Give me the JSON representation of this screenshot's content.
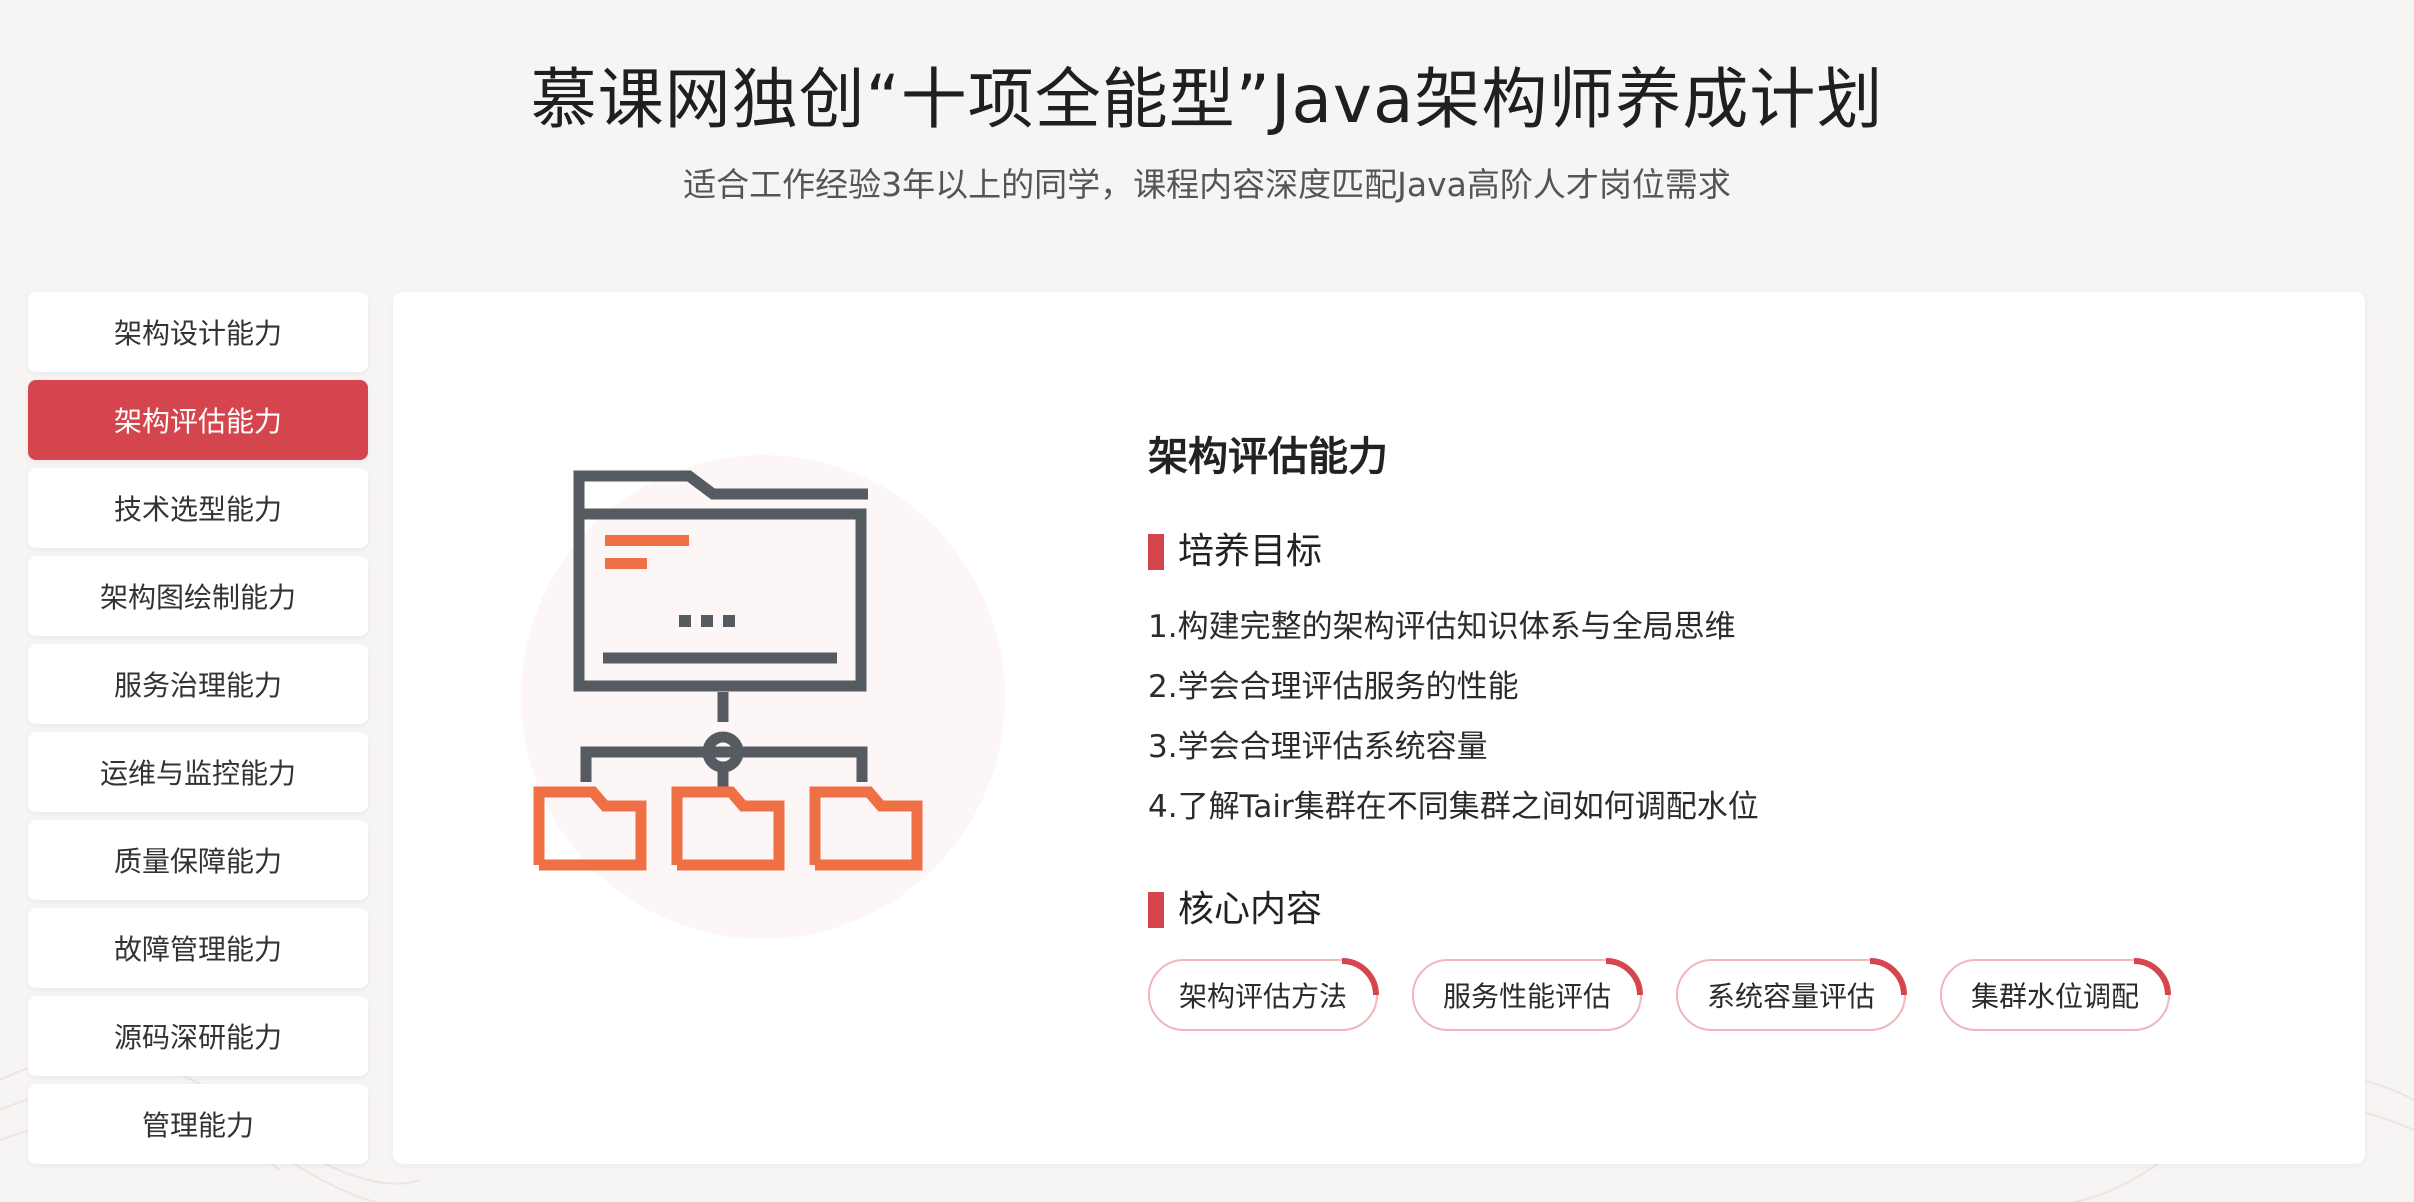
{
  "header": {
    "title": "慕课网独创“十项全能型”Java架构师养成计划",
    "subtitle": "适合工作经验3年以上的同学，课程内容深度匹配Java高阶人才岗位需求"
  },
  "sidebar": {
    "items": [
      {
        "label": "架构设计能力",
        "active": false
      },
      {
        "label": "架构评估能力",
        "active": true
      },
      {
        "label": "技术选型能力",
        "active": false
      },
      {
        "label": "架构图绘制能力",
        "active": false
      },
      {
        "label": "服务治理能力",
        "active": false
      },
      {
        "label": "运维与监控能力",
        "active": false
      },
      {
        "label": "质量保障能力",
        "active": false
      },
      {
        "label": "故障管理能力",
        "active": false
      },
      {
        "label": "源码深研能力",
        "active": false
      },
      {
        "label": "管理能力",
        "active": false
      }
    ]
  },
  "main": {
    "section_title": "架构评估能力",
    "goals_heading": "培养目标",
    "goals": [
      "1.构建完整的架构评估知识体系与全局思维",
      "2.学会合理评估服务的性能",
      "3.学会合理评估系统容量",
      "4.了解Tair集群在不同集群之间如何调配水位"
    ],
    "core_heading": "核心内容",
    "core_tags": [
      "架构评估方法",
      "服务性能评估",
      "系统容量评估",
      "集群水位调配"
    ],
    "illustration_icon": "folder-network-icon"
  },
  "colors": {
    "accent": "#d5454e",
    "orange": "#ef7045",
    "dark_gray": "#555b61",
    "background": "#f7f4f4",
    "tag_border": "#f1b6bb"
  }
}
